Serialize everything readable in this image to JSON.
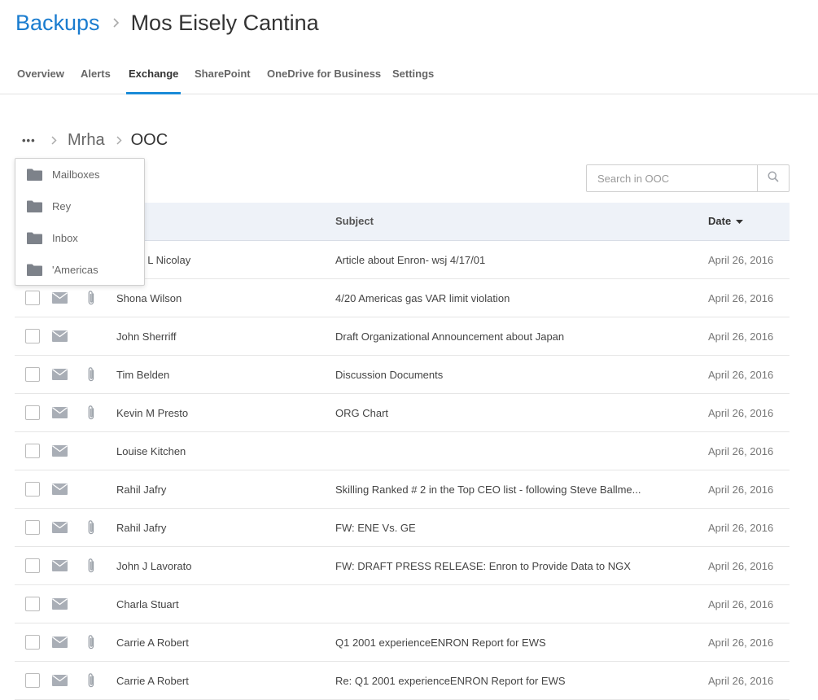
{
  "header": {
    "root": "Backups",
    "title": "Mos Eisely Cantina"
  },
  "tabs": [
    {
      "label": "Overview"
    },
    {
      "label": "Alerts"
    },
    {
      "label": "Exchange"
    },
    {
      "label": "SharePoint"
    },
    {
      "label": "OneDrive for Business"
    },
    {
      "label": "Settings"
    }
  ],
  "active_tab": "Exchange",
  "breadcrumb": {
    "more": "•••",
    "items": [
      {
        "label": "Mrha"
      },
      {
        "label": "OOC"
      }
    ]
  },
  "search": {
    "placeholder": "Search in OOC",
    "value": ""
  },
  "dropdown": {
    "items": [
      {
        "label": "Mailboxes"
      },
      {
        "label": "Rey"
      },
      {
        "label": "Inbox"
      },
      {
        "label": "'Americas"
      }
    ]
  },
  "table": {
    "columns": {
      "subject": "Subject",
      "date": "Date"
    },
    "rows": [
      {
        "from": "Sherri L Nicolay",
        "subject": "Article about Enron- wsj 4/17/01",
        "date": "April 26, 2016",
        "attachment": false
      },
      {
        "from": "Shona Wilson",
        "subject": "4/20 Americas gas VAR limit violation",
        "date": "April 26, 2016",
        "attachment": true
      },
      {
        "from": "John Sherriff",
        "subject": "Draft Organizational Announcement about Japan",
        "date": "April 26, 2016",
        "attachment": false
      },
      {
        "from": "Tim Belden",
        "subject": "Discussion Documents",
        "date": "April 26, 2016",
        "attachment": true
      },
      {
        "from": "Kevin M Presto",
        "subject": "ORG Chart",
        "date": "April 26, 2016",
        "attachment": true
      },
      {
        "from": "Louise Kitchen",
        "subject": "",
        "date": "April 26, 2016",
        "attachment": false
      },
      {
        "from": "Rahil Jafry",
        "subject": "Skilling Ranked # 2 in the Top CEO list - following Steve Ballme...",
        "date": "April 26, 2016",
        "attachment": false
      },
      {
        "from": "Rahil Jafry",
        "subject": "FW: ENE Vs. GE",
        "date": "April 26, 2016",
        "attachment": true
      },
      {
        "from": "John J Lavorato",
        "subject": "FW: DRAFT PRESS RELEASE: Enron to Provide Data to NGX",
        "date": "April 26, 2016",
        "attachment": true
      },
      {
        "from": "Charla Stuart",
        "subject": "",
        "date": "April 26, 2016",
        "attachment": false
      },
      {
        "from": "Carrie A Robert",
        "subject": "Q1 2001 experienceENRON Report for EWS",
        "date": "April 26, 2016",
        "attachment": true
      },
      {
        "from": "Carrie A Robert",
        "subject": "Re: Q1 2001 experienceENRON Report for EWS",
        "date": "April 26, 2016",
        "attachment": true
      }
    ]
  },
  "colors": {
    "accent": "#1a7ccf",
    "tab_underline": "#1a8bd8",
    "header_bg": "#eef2f8",
    "icon": "#a9aeb6"
  },
  "icons": {
    "mail": "envelope-icon",
    "attachment": "paperclip-icon",
    "folder": "folder-icon",
    "search": "search-icon",
    "sort": "caret-down-icon",
    "separator": "chevron-right-icon"
  }
}
